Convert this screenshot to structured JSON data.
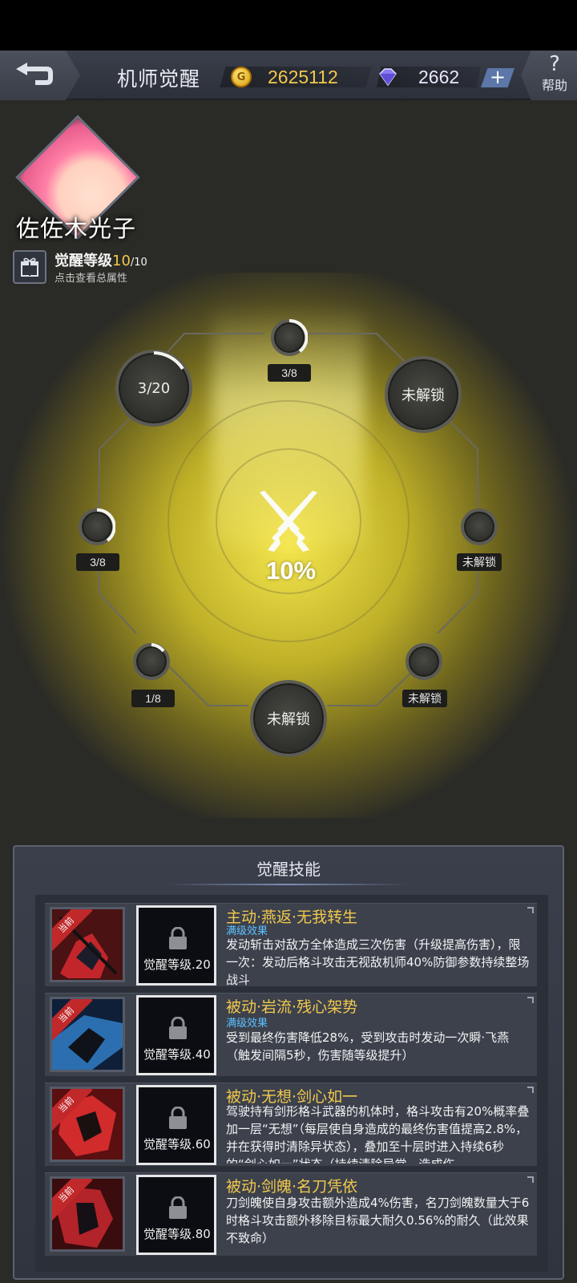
{
  "header": {
    "title": "机师觉醒",
    "gold": "2625112",
    "gems": "2662",
    "plus_label": "+",
    "help_label": "帮助",
    "help_glyph": "?"
  },
  "pilot": {
    "name": "佐佐木光子",
    "level_label": "觉醒等级",
    "level_current": "10",
    "level_max": "/10",
    "view_total": "点击查看总属性"
  },
  "nodes": {
    "top_left_big": "3/20",
    "top_small_tag": "3/8",
    "top_right_big": "未解锁",
    "left_small_tag": "3/8",
    "right_small_tag": "未解锁",
    "bottom_left_small_tag": "1/8",
    "bottom_right_small_tag": "未解锁",
    "bottom_big": "未解锁",
    "center_percent": "10%"
  },
  "skills_panel": {
    "title": "觉醒技能",
    "current_ribbon": "当前",
    "skills": [
      {
        "name": "主动·燕返·无我转生",
        "effect": "满级效果",
        "lock_label": "觉醒等级.20",
        "desc": "发动斩击对敌方全体造成三次伤害（升级提高伤害），限一次：发动后格斗攻击无视敌机师40%防御参数持续整场战斗"
      },
      {
        "name": "被动·岩流·残心架势",
        "effect": "满级效果",
        "lock_label": "觉醒等级.40",
        "desc": "受到最终伤害降低28%，受到攻击时发动一次瞬·飞燕（触发间隔5秒，伤害随等级提升）"
      },
      {
        "name": "被动·无想·剑心如一",
        "effect": "",
        "lock_label": "觉醒等级.60",
        "desc": "驾驶持有剑形格斗武器的机体时，格斗攻击有20%概率叠加一层“无想”（每层使自身造成的最终伤害值提高2.8%，并在获得时清除异状态），叠加至十层时进入持续6秒的“剑心如一”状态（持续清除异常，造成伤"
      },
      {
        "name": "被动·剑魄·名刀凭依",
        "effect": "",
        "lock_label": "觉醒等级.80",
        "desc": "刀剑魄使自身攻击额外造成4%伤害，名刀剑魄数量大于6时格斗攻击额外移除目标最大耐久0.56%的耐久（此效果不致命）"
      }
    ]
  },
  "colors": {
    "accent_gold": "#f2c94c",
    "effect_blue": "#5dc2ff",
    "ribbon_red": "#c0282a"
  }
}
